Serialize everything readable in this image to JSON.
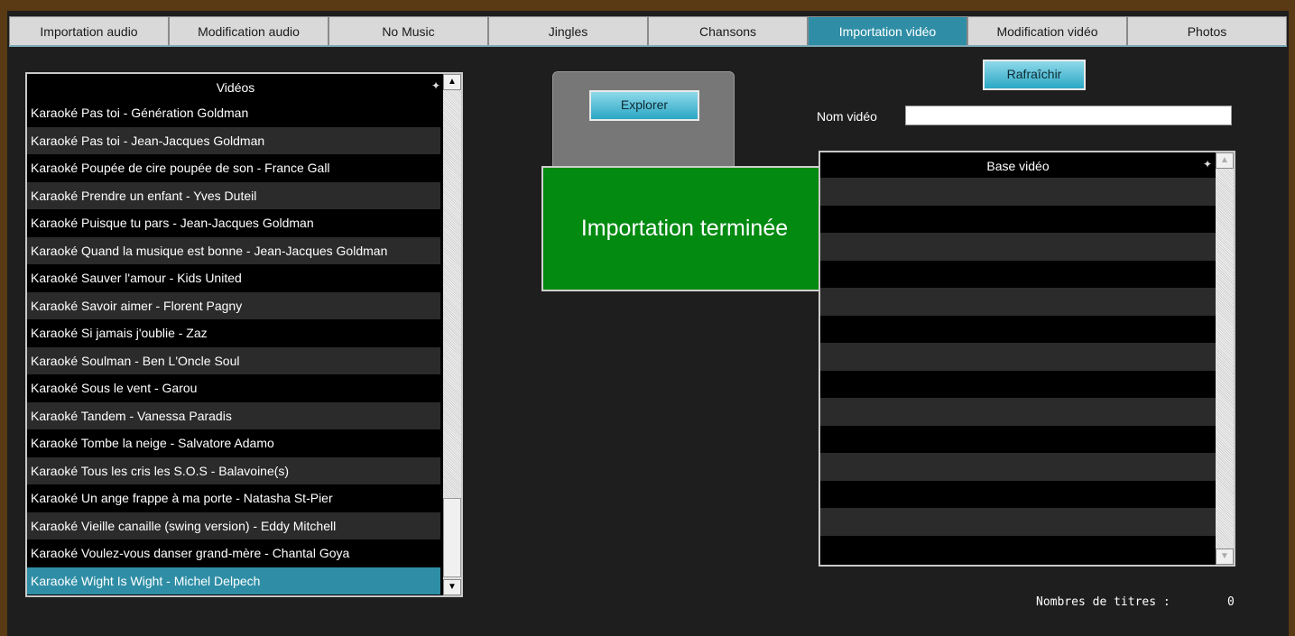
{
  "tabs": [
    {
      "label": "Importation audio"
    },
    {
      "label": "Modification audio"
    },
    {
      "label": "No Music"
    },
    {
      "label": "Jingles"
    },
    {
      "label": "Chansons"
    },
    {
      "label": "Importation vidéo"
    },
    {
      "label": "Modification vidéo"
    },
    {
      "label": "Photos"
    }
  ],
  "active_tab": "Importation vidéo",
  "videos": {
    "header": "Vidéos",
    "items": [
      "Karaoké Pas toi - Génération Goldman",
      "Karaoké Pas toi - Jean-Jacques Goldman",
      "Karaoké Poupée de cire poupée de son - France Gall",
      "Karaoké Prendre un enfant - Yves Duteil",
      "Karaoké Puisque tu pars - Jean-Jacques Goldman",
      "Karaoké Quand la musique est bonne - Jean-Jacques Goldman",
      "Karaoké Sauver l'amour - Kids United",
      "Karaoké Savoir aimer - Florent Pagny",
      "Karaoké Si jamais j'oublie - Zaz",
      "Karaoké Soulman - Ben L'Oncle Soul",
      "Karaoké Sous le vent - Garou",
      "Karaoké Tandem - Vanessa Paradis",
      "Karaoké Tombe la neige - Salvatore Adamo",
      "Karaoké Tous les cris les S.O.S - Balavoine(s)",
      "Karaoké Un ange frappe à ma porte - Natasha St-Pier",
      "Karaoké Vieille canaille (swing version) - Eddy Mitchell",
      "Karaoké Voulez-vous danser grand-mère - Chantal Goya",
      "Karaoké Wight Is Wight - Michel Delpech"
    ],
    "selected": "Karaoké Wight Is Wight - Michel Delpech"
  },
  "explorer_button": "Explorer",
  "import_message": "Importation terminée",
  "refresh_button": "Rafraîchir",
  "nom_video": {
    "label": "Nom vidéo",
    "value": ""
  },
  "base_video": {
    "header": "Base vidéo",
    "rows": 14
  },
  "count": {
    "label": "Nombres de titres :",
    "value": "0"
  },
  "colors": {
    "active_tab": "#2f8ea6",
    "import_bg": "#028a11",
    "frame": "#5a3a14"
  }
}
